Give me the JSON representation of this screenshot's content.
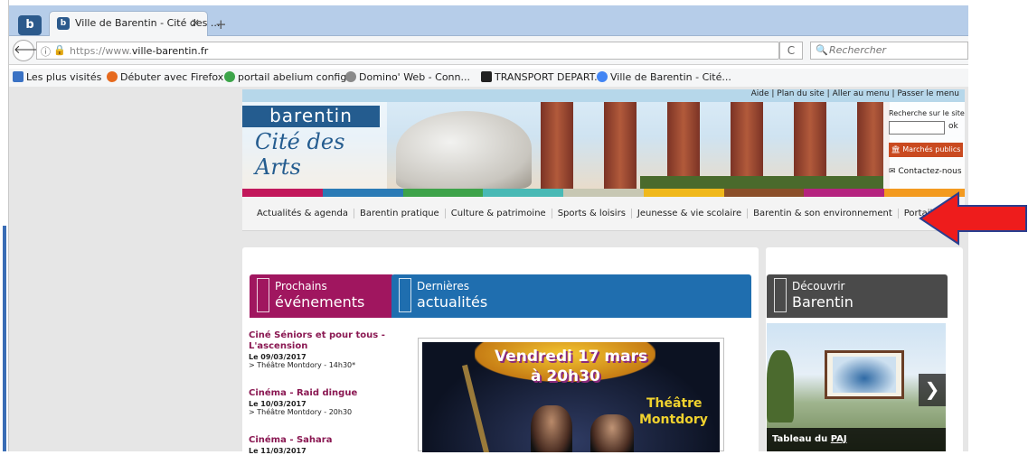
{
  "browser": {
    "app_button": "b",
    "tab": {
      "favicon": "b",
      "title": "Ville de Barentin - Cité des ...",
      "close": "×"
    },
    "new_tab": "+",
    "back": "🡐",
    "info_icon": "ⓘ",
    "lock_icon": "🔒",
    "url_prefix": "https://www.",
    "url_domain": "ville-barentin.fr",
    "reload": "C",
    "search_icon": "🔍",
    "search_placeholder": "Rechercher",
    "bookmarks": [
      {
        "label": "Les plus visités",
        "icon_color": "#3a72c4"
      },
      {
        "label": "Débuter avec Firefox",
        "icon_color": "#e66a1e"
      },
      {
        "label": "portail abelium config",
        "icon_color": "#3da54a"
      },
      {
        "label": "Domino' Web - Conn...",
        "icon_color": "#8a8a8a"
      },
      {
        "label": "TRANSPORT DEPART...",
        "icon_color": "#222222"
      },
      {
        "label": "Ville de Barentin - Cité...",
        "icon_color": "#4285f4"
      }
    ]
  },
  "site": {
    "top_links": "Aide | Plan du site | Aller au menu | Passer le menu",
    "logo_top": "barentin",
    "logo_sub": "Cité des Arts",
    "search_label": "Recherche sur le site",
    "search_ok": "ok",
    "marches_button": "🏛 Marchés publics",
    "contact_link": "✉  Contactez-nous",
    "color_bar": [
      "#c2185b",
      "#2b7bb6",
      "#3ea34a",
      "#49b9b5",
      "#c7c7b3",
      "#f0b81b",
      "#8b4f2a",
      "#b5237f",
      "#f39a1f"
    ],
    "menu": [
      "Actualités & agenda",
      "Barentin pratique",
      "Culture & patrimoine",
      "Sports & loisirs",
      "Jeunesse & vie scolaire",
      "Barentin & son environnement",
      "Portail Famille"
    ],
    "events_head": {
      "line1": "Prochains",
      "line2": "événements",
      "color": "#a0165f"
    },
    "news_head": {
      "line1": "Dernières",
      "line2": "actualités",
      "color": "#1f6eaf"
    },
    "discover_head": {
      "line1": "Découvrir",
      "line2": "Barentin",
      "color": "#4a4a4a"
    },
    "events": [
      {
        "title": "Ciné Séniors et pour tous - L'ascension",
        "date": "Le 09/03/2017",
        "place": "> Théâtre Montdory - 14h30*"
      },
      {
        "title": "Cinéma - Raid dingue",
        "date": "Le 10/03/2017",
        "place": "> Théâtre Montdory - 20h30"
      },
      {
        "title": "Cinéma - Sahara",
        "date": "Le 11/03/2017",
        "place": ""
      }
    ],
    "poster": {
      "line1": "Vendredi 17 mars",
      "line2": "à 20h30",
      "line3": "Théâtre",
      "line4": "Montdory"
    },
    "discover_caption_prefix": "Tableau du ",
    "discover_caption_abbr": "PAJ",
    "discover_next": "❯"
  }
}
